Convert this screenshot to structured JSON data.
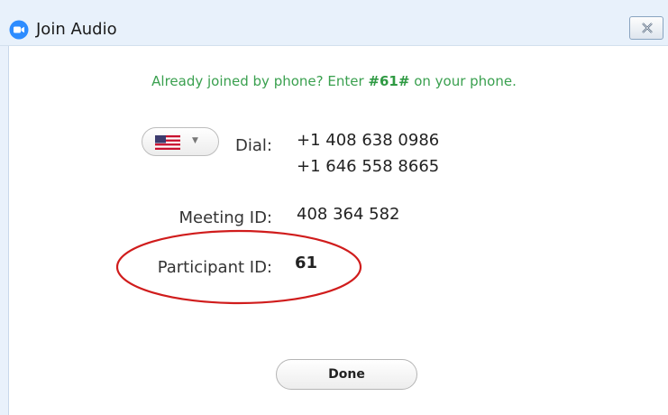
{
  "window": {
    "title": "Join Audio",
    "icon": "zoom-logo-icon",
    "close_icon": "close-icon"
  },
  "hint": {
    "prefix": "Already joined by phone? Enter ",
    "code": "#61#",
    "suffix": " on your phone."
  },
  "dial": {
    "country_flag": "us-flag-icon",
    "label": "Dial:",
    "numbers": [
      "+1 408 638 0986",
      "+1 646 558 8665"
    ]
  },
  "meeting": {
    "label": "Meeting ID:",
    "value": "408 364 582"
  },
  "participant": {
    "label": "Participant ID:",
    "value": "61"
  },
  "done_label": "Done",
  "colors": {
    "hint_green": "#3aa04f",
    "annotation_red": "#d01c1c",
    "zoom_blue": "#2d8cff"
  }
}
